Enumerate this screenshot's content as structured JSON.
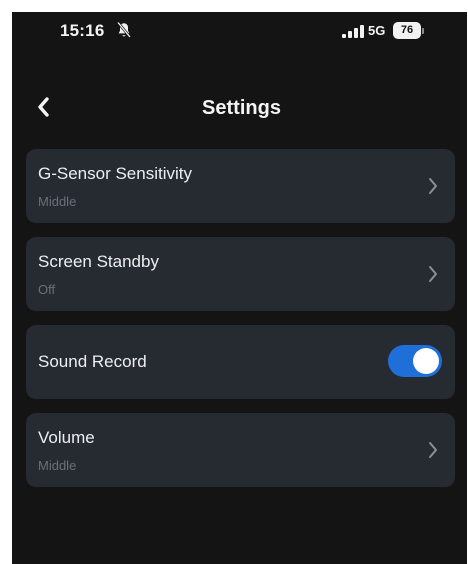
{
  "status_bar": {
    "time": "15:16",
    "network": "5G",
    "battery": "76",
    "icons": [
      "bell-slash-icon",
      "cellular-signal-icon",
      "battery-icon"
    ]
  },
  "header": {
    "title": "Settings",
    "back_icon": "chevron-left-icon"
  },
  "settings": {
    "g_sensor": {
      "title": "G-Sensor Sensitivity",
      "value": "Middle",
      "icon": "chevron-right-icon"
    },
    "screen_standby": {
      "title": "Screen Standby",
      "value": "Off",
      "icon": "chevron-right-icon"
    },
    "sound_record": {
      "title": "Sound Record",
      "enabled": true
    },
    "volume": {
      "title": "Volume",
      "value": "Middle",
      "icon": "chevron-right-icon"
    }
  },
  "colors": {
    "background": "#141414",
    "card": "#262a31",
    "toggle_on": "#1f6fd9",
    "subtitle": "#6b7079"
  }
}
